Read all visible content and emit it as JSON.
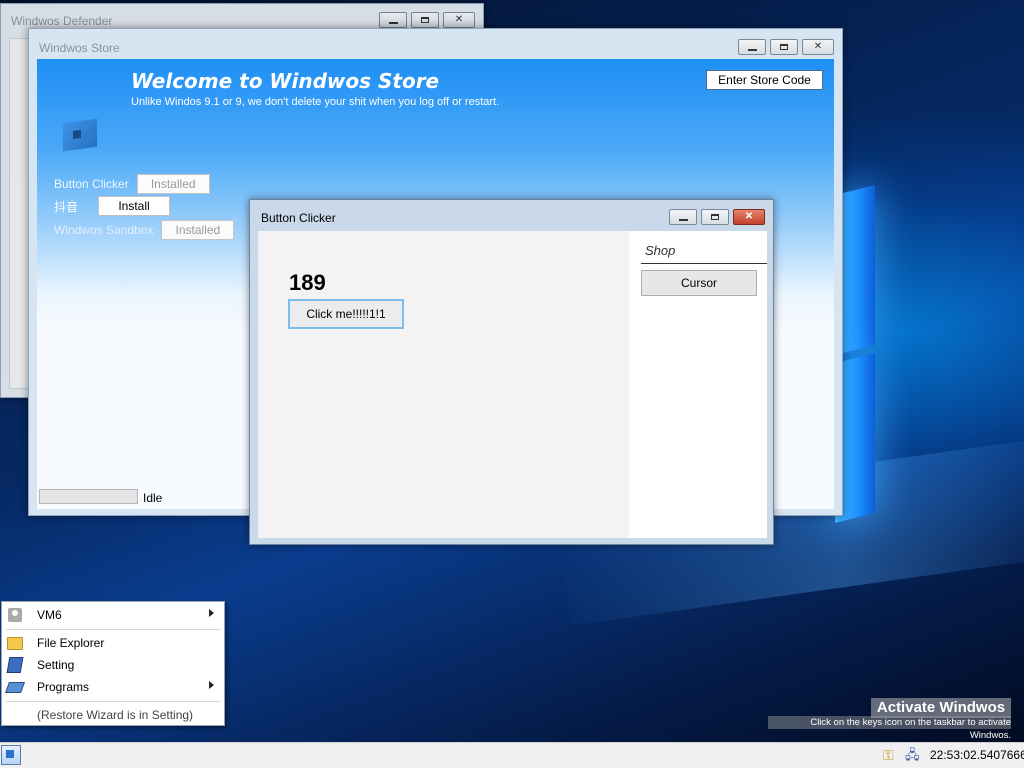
{
  "windows": {
    "defender": {
      "title": "Windwos Defender"
    },
    "store": {
      "title": "Windwos Store",
      "heading": "Welcome to Windwos Store",
      "subtitle": "Unlike Windos 9.1 or 9, we don't delete your shit when you log off or restart.",
      "store_code_label": "Enter Store Code",
      "apps": [
        {
          "name": "Button Clicker",
          "button_label": "Installed"
        },
        {
          "name": "抖音",
          "button_label": "Install"
        },
        {
          "name": "Windwos Sandbox",
          "button_label": "Installed"
        }
      ],
      "status": "Idle",
      "progress": 0
    },
    "clicker": {
      "title": "Button Clicker",
      "score": "189",
      "click_label": "Click me!!!!!1!1",
      "shop_title": "Shop",
      "shop_items": [
        "Cursor"
      ]
    }
  },
  "start_menu": {
    "items": [
      {
        "label": "VM6",
        "icon": "user-icon",
        "submenu": true
      },
      {
        "label": "File Explorer",
        "icon": "folder-icon",
        "submenu": false
      },
      {
        "label": "Setting",
        "icon": "setting-icon",
        "submenu": false
      },
      {
        "label": "Programs",
        "icon": "programs-icon",
        "submenu": true
      }
    ],
    "footer": "(Restore Wizard is in Setting)"
  },
  "watermark": {
    "title": "Activate Windwos",
    "message": "Click on the keys icon on the taskbar to activate Windwos."
  },
  "taskbar": {
    "clock": "22:53:02.5407666",
    "tray_icons": [
      "keys-icon",
      "network-icon"
    ]
  },
  "colors": {
    "store_header_blue": "#1e8ff5",
    "desktop_blue": "#0a3d8f",
    "clicker_button_border": "#7fbde8"
  }
}
